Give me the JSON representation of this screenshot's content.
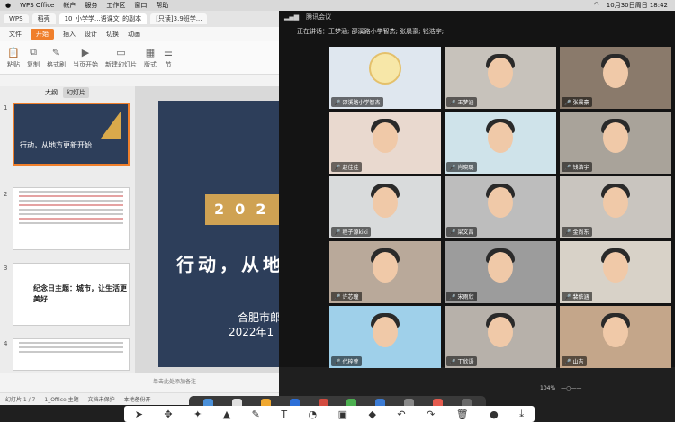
{
  "menubar": {
    "app": "WPS Office",
    "items": [
      "帐户",
      "服务",
      "工作区",
      "窗口",
      "帮助"
    ],
    "clock": "10月30日周日 18:42"
  },
  "wps": {
    "tabs": [
      "WPS",
      "稻壳",
      "10_小学学...语课文_的副本",
      "[只读]3.9班学..."
    ],
    "ribbon_tabs": [
      "文件",
      "开始",
      "插入",
      "设计",
      "切换",
      "动画"
    ],
    "active_tab": "开始",
    "ribbon_buttons": [
      "粘贴",
      "复制",
      "格式刷",
      "当页开始",
      "新建幻灯片",
      "版式",
      "节"
    ],
    "side_tabs": [
      "大纲",
      "幻灯片"
    ],
    "thumbs": [
      {
        "num": "1",
        "title": "行动，从地方更新开始"
      },
      {
        "num": "2"
      },
      {
        "num": "3",
        "title": "纪念日主题：城市，让生活更美好"
      },
      {
        "num": "4"
      }
    ],
    "slide": {
      "gold": "202",
      "headline": "行动，从地",
      "sub1": "合肥市郎",
      "sub2": "2022年1"
    },
    "notes": "单击此处添加备注",
    "status": [
      "幻灯片 1 / 7",
      "1_Office 主题",
      "文档未保护",
      "本地备份开"
    ],
    "zoom": "104%"
  },
  "meeting": {
    "title": "腾讯会议",
    "speaking_label": "正在讲话：王梦涵; 邵溪路小学智杰; 张晨豪; 钱浩宇;",
    "participants": [
      "邵溪路小学智杰",
      "王梦涵",
      "张晨豪",
      "赵佳佳",
      "肖晓璐",
      "钱浩宇",
      "程子源kiki",
      "梁文昌",
      "金尚东",
      "许芯瞳",
      "宋雨欣",
      "裴依涵",
      "代梓萱",
      "丁欣语",
      "山吉"
    ]
  },
  "toolbar": {
    "icons": [
      "cursor-icon",
      "move-icon",
      "magic-icon",
      "marker-icon",
      "pen-icon",
      "text-icon",
      "shape-icon",
      "sticker-icon",
      "eraser-icon",
      "undo-icon",
      "redo-icon",
      "trash-icon",
      "user-icon",
      "download-icon"
    ]
  }
}
